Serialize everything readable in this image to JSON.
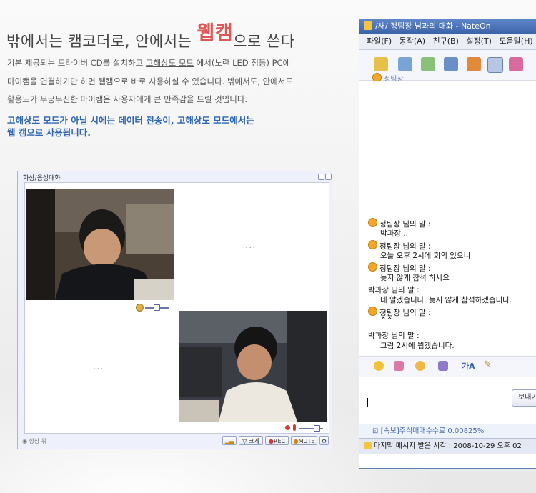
{
  "headline": {
    "part1": "밖에서는 캠코더로, 안에서는 ",
    "highlight": "웹캠",
    "part2": "으로 쓴다"
  },
  "description": {
    "line1_a": "기본 제공되는 드라이버 CD를 설치하고 ",
    "line1_u": "고해상도 모드",
    "line1_b": " 에서(노란 LED 점등) PC에",
    "line2": "마이캠을 연결하기만 하면 웹캠으로 바로 사용하실 수 있습니다. 밖에서도, 안에서도",
    "line3": "활용도가 무궁무진한 마이캠은 사용자에게 큰 만족감을 드릴 것입니다."
  },
  "notice": {
    "line1": "고해상도 모드가 아닐 시에는 데이터 전송이, 고해상도 모드에서는",
    "line2": "웹 캠으로 사용됩니다."
  },
  "video_window": {
    "title": "화상/음성대화",
    "placeholder": "...",
    "always_on_top": "항상 위",
    "btn_size": "크게",
    "btn_rec": "REC",
    "btn_mute": "MUTE"
  },
  "nateon": {
    "title": "/새/ 정팀장 님과의 대화  - NateOn",
    "menu": [
      "파일(F)",
      "동작(A)",
      "친구(B)",
      "설정(T)",
      "도움말(H)"
    ],
    "contact_name": "정팀장",
    "messages": [
      {
        "speaker": "정팀장 님의 말 :",
        "text": "박과장 ..",
        "icon": true
      },
      {
        "speaker": "정팀장 님의 말 :",
        "text": "오늘 오후 2시에 회의 있으니",
        "icon": true
      },
      {
        "speaker": "정팀장 님의 말 :",
        "text": "늦지 않게 참석 하세요",
        "icon": true
      },
      {
        "speaker": "박과장 님의 말 :",
        "text": "네 알겠습니다. 늦지 않게 참석하겠습니다.",
        "icon": false
      },
      {
        "speaker": "정팀장 님의 말 :",
        "text": "^^",
        "icon": true
      },
      {
        "speaker": "박과장 님의 말 :",
        "text": "그럼 2시에 뵙겠습니다.",
        "icon": false
      }
    ],
    "send_label": "보내기",
    "news": "[속보]주식매매수수료 0.00825%",
    "last_msg": "마지막 메시지 받은 시각 : 2008-10-29 오후 02"
  },
  "colors": {
    "accent_red": "#e05656",
    "notice_blue": "#2f66b3",
    "nateon_title": "#4a70b5"
  }
}
